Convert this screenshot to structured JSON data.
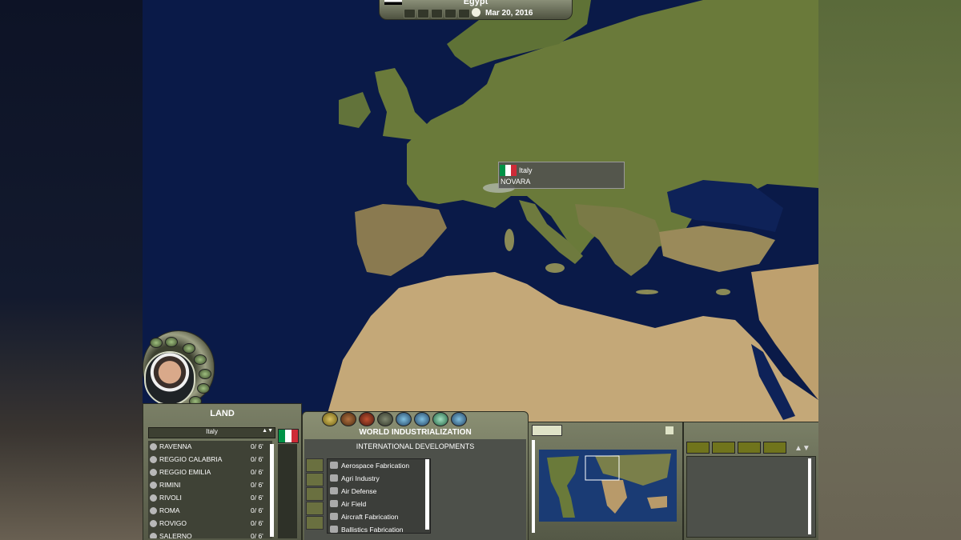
{
  "top_bar": {
    "country": "Egypt",
    "date": "Mar 20, 2016"
  },
  "tooltip": {
    "country": "Italy",
    "city": "NOVARA",
    "flag_colors": [
      "#009246",
      "#ffffff",
      "#ce2b37"
    ]
  },
  "land_panel": {
    "title": "LAND",
    "selected_country": "Italy",
    "cities": [
      {
        "name": "RAVENNA",
        "value": "0/ 6'"
      },
      {
        "name": "REGGIO CALABRIA",
        "value": "0/ 6'"
      },
      {
        "name": "REGGIO EMILIA",
        "value": "0/ 6'"
      },
      {
        "name": "RIMINI",
        "value": "0/ 6'"
      },
      {
        "name": "RIVOLI",
        "value": "0/ 6'"
      },
      {
        "name": "ROMA",
        "value": "0/ 6'"
      },
      {
        "name": "ROVIGO",
        "value": "0/ 6'"
      },
      {
        "name": "SALERNO",
        "value": "0/ 6'"
      }
    ]
  },
  "center_panel": {
    "title": "WORLD INDUSTRIALIZATION",
    "subtitle": "INTERNATIONAL DEVELOPMENTS",
    "developments": [
      "Aerospace Fabrication",
      "Agri Industry",
      "Air Defense",
      "Air Field",
      "Aircraft Fabrication",
      "Ballistics Fabrication"
    ]
  },
  "icons": {
    "dial": [
      "globe-icon",
      "military-icon",
      "economy-icon",
      "resources-icon",
      "treaty-icon",
      "research-icon",
      "settings-icon"
    ],
    "center": [
      "industry-icon",
      "agriculture-icon",
      "oil-icon",
      "military-unit-icon",
      "globe-icon",
      "globe-icon",
      "globe-icon",
      "globe-icon"
    ]
  },
  "colors": {
    "ocean": "#0b1a44",
    "panel": "#6c705a",
    "accent_green": "#9fbf7f"
  }
}
